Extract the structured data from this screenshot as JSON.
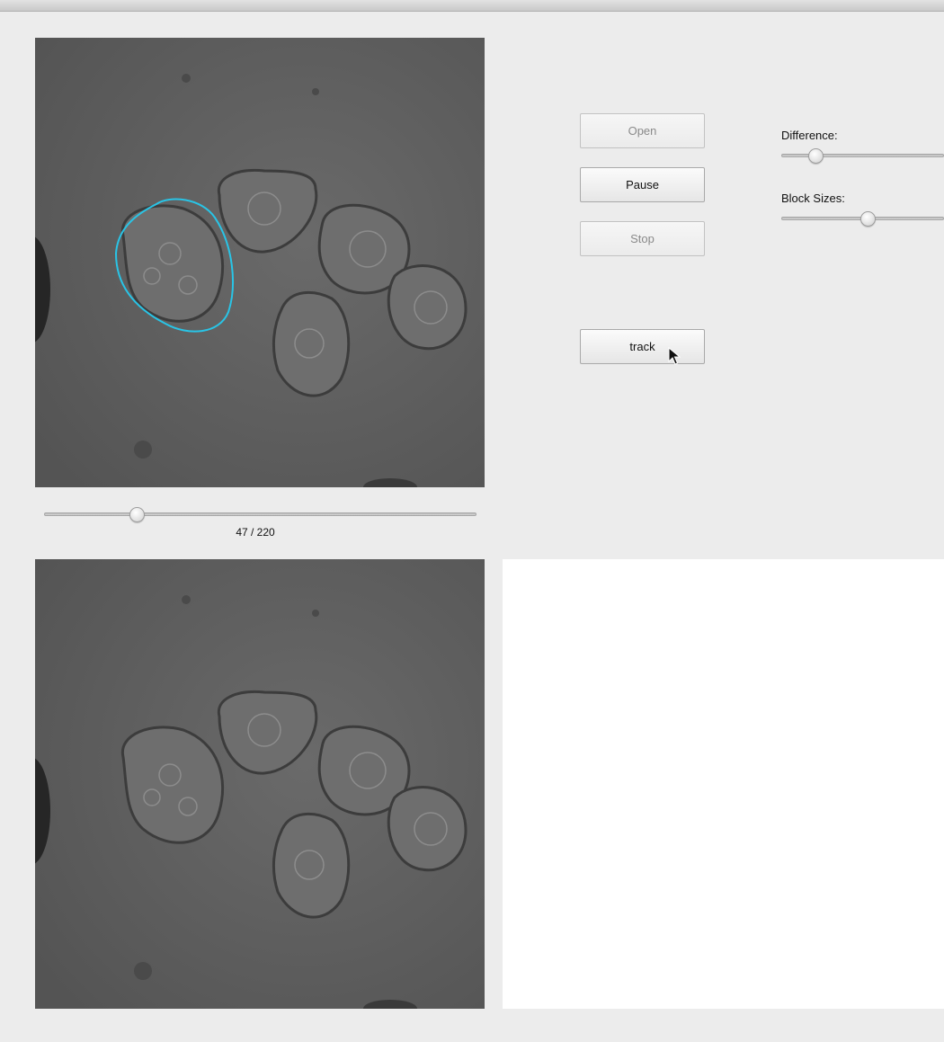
{
  "controls": {
    "open_label": "Open",
    "pause_label": "Pause",
    "stop_label": "Stop",
    "track_label": "track",
    "open_enabled": false,
    "pause_enabled": true,
    "stop_enabled": false
  },
  "sliders": {
    "difference": {
      "label": "Difference:",
      "value_fraction": 0.21
    },
    "block_sizes": {
      "label": "Block Sizes:",
      "value_fraction": 0.53
    }
  },
  "playback": {
    "current_frame": 47,
    "total_frames": 220,
    "counter_text": "47 / 220"
  },
  "colors": {
    "window_background": "#ececec",
    "tracking_contour": "#29c4e6",
    "empty_panel": "#ffffff"
  },
  "icons": {
    "pointer": "mouse-pointer-icon"
  }
}
